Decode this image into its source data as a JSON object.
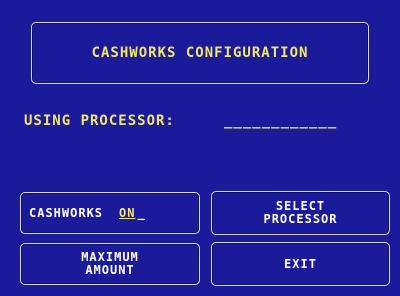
{
  "screen": {
    "title": "CASHWORKS CONFIGURATION",
    "processor_label": "USING PROCESSOR:",
    "processor_value": "____________"
  },
  "buttons": {
    "cashworks_label": "CASHWORKS",
    "cashworks_status": "ON",
    "cashworks_cursor": "_",
    "select_processor_label": "SELECT\nPROCESSOR",
    "maximum_amount_label": "MAXIMUM\nAMOUNT",
    "exit_label": "EXIT"
  },
  "colors": {
    "background": "#1a1a9a",
    "heading_text": "#f2e66a",
    "button_text": "#ffffff",
    "border": "#d8d8f0"
  }
}
